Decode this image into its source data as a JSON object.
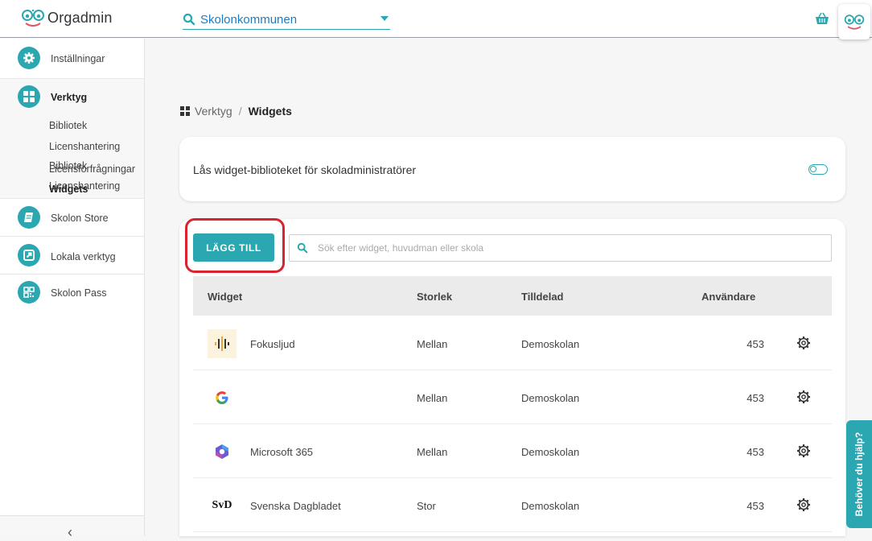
{
  "app": {
    "name": "Orgadmin"
  },
  "org_select": {
    "value": "Skolonkommunen"
  },
  "sidebar": {
    "items": [
      {
        "label": "Inställningar",
        "icon": "gear-icon"
      },
      {
        "label": "Verktyg",
        "icon": "grid-icon"
      },
      {
        "label": "Skolon Store",
        "icon": "book-icon"
      },
      {
        "label": "Lokala verktyg",
        "icon": "external-link-icon"
      },
      {
        "label": "Skolon Pass",
        "icon": "qr-icon"
      }
    ],
    "verktyg_sub": [
      "Bibliotek",
      "Licenshantering",
      "Licensförfrågningar",
      "Widgets"
    ],
    "collapse": "‹"
  },
  "breadcrumb": {
    "parent": "Verktyg",
    "separator": "/",
    "current": "Widgets"
  },
  "lock_setting": {
    "label": "Lås widget-biblioteket för skoladministratörer",
    "enabled": false
  },
  "toolbar": {
    "add_label": "LÄGG TILL",
    "search_placeholder": "Sök efter widget, huvudman eller skola"
  },
  "table": {
    "headers": [
      "Widget",
      "Storlek",
      "Tilldelad",
      "Användare"
    ],
    "rows": [
      {
        "name": "Fokusljud",
        "size": "Mellan",
        "assigned": "Demoskolan",
        "users": "453",
        "logo": "fokusljud-logo"
      },
      {
        "name": "",
        "size": "Mellan",
        "assigned": "Demoskolan",
        "users": "453",
        "logo": "google-logo"
      },
      {
        "name": "Microsoft 365",
        "size": "Mellan",
        "assigned": "Demoskolan",
        "users": "453",
        "logo": "microsoft-365-logo"
      },
      {
        "name": "Svenska Dagbladet",
        "size": "Stor",
        "assigned": "Demoskolan",
        "users": "453",
        "logo": "svd-logo",
        "logo_text": "SvD"
      }
    ]
  },
  "help": {
    "label": "Behöver du hjälp?"
  },
  "colors": {
    "accent": "#2aa7b0",
    "highlight": "#d9232e"
  }
}
